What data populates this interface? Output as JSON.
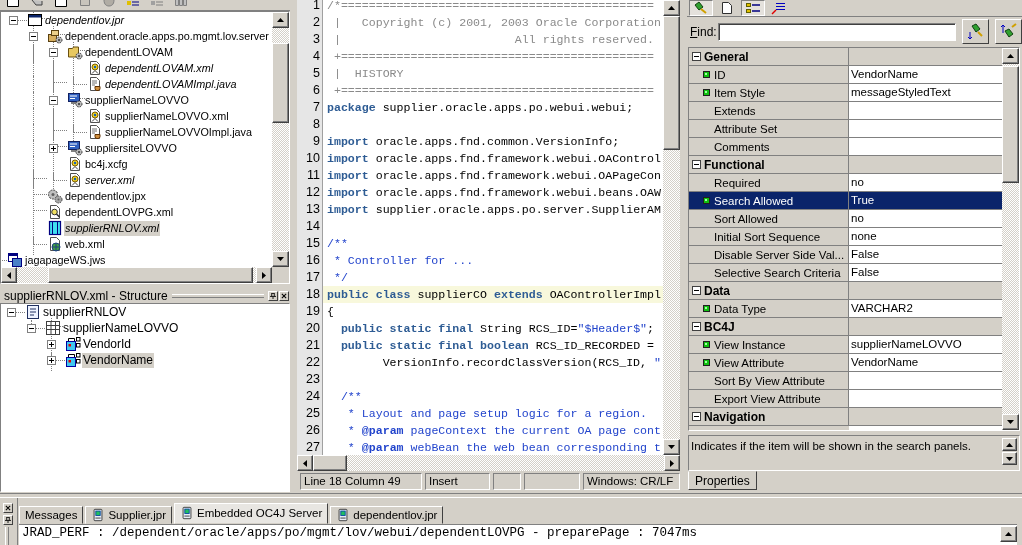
{
  "navigator": {
    "items": [
      {
        "label": "dependentlov.jpr",
        "kind": "project",
        "expanded": true,
        "modified": true,
        "selected": false,
        "children": [
          {
            "label": "dependent.oracle.apps.po.mgmt.lov.server",
            "kind": "package",
            "expanded": true,
            "modified": false,
            "selected": false,
            "children": [
              {
                "label": "dependentLOVAM",
                "kind": "module",
                "expanded": true,
                "modified": false,
                "selected": false,
                "children": [
                  {
                    "label": "dependentLOVAM.xml",
                    "kind": "xml",
                    "modified": true,
                    "selected": false
                  },
                  {
                    "label": "dependentLOVAMImpl.java",
                    "kind": "java",
                    "modified": true,
                    "selected": false
                  }
                ]
              },
              {
                "label": "supplierNameLOVVO",
                "kind": "view",
                "expanded": true,
                "modified": false,
                "selected": false,
                "children": [
                  {
                    "label": "supplierNameLOVVO.xml",
                    "kind": "xml",
                    "modified": false,
                    "selected": false
                  },
                  {
                    "label": "supplierNameLOVVOImpl.java",
                    "kind": "java",
                    "modified": false,
                    "selected": false
                  }
                ]
              },
              {
                "label": "suppliersiteLOVVO",
                "kind": "view",
                "expanded": false,
                "modified": false,
                "selected": false
              },
              {
                "label": "bc4j.xcfg",
                "kind": "xml",
                "modified": false,
                "selected": false
              },
              {
                "label": "server.xml",
                "kind": "xml",
                "modified": true,
                "selected": false
              }
            ]
          },
          {
            "label": "dependentlov.jpx",
            "kind": "gears",
            "modified": false,
            "selected": false
          },
          {
            "label": "dependentLOVPG.xml",
            "kind": "page",
            "modified": false,
            "selected": false
          },
          {
            "label": "supplierRNLOV.xml",
            "kind": "region",
            "modified": true,
            "selected": true
          },
          {
            "label": "web.xml",
            "kind": "web",
            "modified": false,
            "selected": false
          }
        ]
      },
      {
        "label": "jagapageWS.jws",
        "kind": "workspace",
        "modified": false,
        "selected": false
      }
    ]
  },
  "structure": {
    "title": "supplierRNLOV.xml - Structure",
    "items": [
      {
        "label": "supplierRNLOV",
        "kind": "document",
        "expanded": true,
        "selected": false,
        "children": [
          {
            "label": "supplierNameLOVVO",
            "kind": "table",
            "expanded": true,
            "selected": false,
            "children": [
              {
                "label": "VendorId",
                "kind": "item",
                "expanded": false,
                "selected": false
              },
              {
                "label": "VendorName",
                "kind": "item",
                "expanded": false,
                "selected": true
              }
            ]
          }
        ]
      }
    ]
  },
  "editor": {
    "lines": [
      {
        "number": "1",
        "current": false,
        "tokens": [
          {
            "kind": "comment",
            "text": "/*============================================="
          }
        ]
      },
      {
        "number": "2",
        "current": false,
        "tokens": [
          {
            "kind": "comment",
            "text": " |   Copyright (c) 2001, 2003 Oracle Corporation"
          }
        ]
      },
      {
        "number": "3",
        "current": false,
        "tokens": [
          {
            "kind": "comment",
            "text": " |                         All rights reserved."
          }
        ]
      },
      {
        "number": "4",
        "current": false,
        "tokens": [
          {
            "kind": "comment",
            "text": " +============================================="
          }
        ]
      },
      {
        "number": "5",
        "current": false,
        "tokens": [
          {
            "kind": "comment",
            "text": " |  HISTORY"
          }
        ]
      },
      {
        "number": "6",
        "current": false,
        "tokens": [
          {
            "kind": "comment",
            "text": " +============================================="
          }
        ]
      },
      {
        "number": "7",
        "current": false,
        "tokens": [
          {
            "kind": "keyword",
            "text": "package"
          },
          {
            "kind": "plain",
            "text": " supplier.oracle.apps.po.webui.webui;"
          }
        ]
      },
      {
        "number": "8"
      },
      {
        "number": "9",
        "current": false,
        "tokens": [
          {
            "kind": "keyword",
            "text": "import"
          },
          {
            "kind": "plain",
            "text": " oracle.apps.fnd.common.VersionInfo;"
          }
        ]
      },
      {
        "number": "10",
        "current": false,
        "tokens": [
          {
            "kind": "keyword",
            "text": "import"
          },
          {
            "kind": "plain",
            "text": " oracle.apps.fnd.framework.webui.OAControl"
          }
        ]
      },
      {
        "number": "11",
        "current": false,
        "tokens": [
          {
            "kind": "keyword",
            "text": "import"
          },
          {
            "kind": "plain",
            "text": " oracle.apps.fnd.framework.webui.OAPageCon"
          }
        ]
      },
      {
        "number": "12",
        "current": false,
        "tokens": [
          {
            "kind": "keyword",
            "text": "import"
          },
          {
            "kind": "plain",
            "text": " oracle.apps.fnd.framework.webui.beans.OAW"
          }
        ]
      },
      {
        "number": "13",
        "current": false,
        "tokens": [
          {
            "kind": "keyword",
            "text": "import"
          },
          {
            "kind": "plain",
            "text": " supplier.oracle.apps.po.server.SupplierAM"
          }
        ]
      },
      {
        "number": "14"
      },
      {
        "number": "15",
        "current": false,
        "tokens": [
          {
            "kind": "doc",
            "text": "/**"
          }
        ]
      },
      {
        "number": "16",
        "current": false,
        "tokens": [
          {
            "kind": "doc",
            "text": " * Controller for ..."
          }
        ]
      },
      {
        "number": "17",
        "current": false,
        "tokens": [
          {
            "kind": "doc",
            "text": " */"
          }
        ]
      },
      {
        "number": "18",
        "current": true,
        "tokens": [
          {
            "kind": "keyword",
            "text": "public class"
          },
          {
            "kind": "plain",
            "text": " supplierCO "
          },
          {
            "kind": "keyword",
            "text": "extends"
          },
          {
            "kind": "plain",
            "text": " OAControllerImpl"
          }
        ]
      },
      {
        "number": "19",
        "current": false,
        "tokens": [
          {
            "kind": "plain",
            "text": "{"
          }
        ]
      },
      {
        "number": "20",
        "current": false,
        "tokens": [
          {
            "kind": "keyword",
            "text": "  public static final"
          },
          {
            "kind": "plain",
            "text": " String RCS_ID="
          },
          {
            "kind": "string",
            "text": "\"$Header$\""
          },
          {
            "kind": "plain",
            "text": ";"
          }
        ]
      },
      {
        "number": "21",
        "current": false,
        "tokens": [
          {
            "kind": "keyword",
            "text": "  public static final boolean"
          },
          {
            "kind": "plain",
            "text": " RCS_ID_RECORDED ="
          }
        ]
      },
      {
        "number": "22",
        "current": false,
        "tokens": [
          {
            "kind": "plain",
            "text": "        VersionInfo.recordClassVersion(RCS_ID, "
          },
          {
            "kind": "string",
            "text": "\""
          }
        ]
      },
      {
        "number": "23"
      },
      {
        "number": "24",
        "current": false,
        "tokens": [
          {
            "kind": "doc",
            "text": "  /**"
          }
        ]
      },
      {
        "number": "25",
        "current": false,
        "tokens": [
          {
            "kind": "doc",
            "text": "   * Layout and page setup logic for a region."
          }
        ]
      },
      {
        "number": "26",
        "current": false,
        "tokens": [
          {
            "kind": "doc",
            "text": "   * "
          },
          {
            "kind": "doctag",
            "text": "@param"
          },
          {
            "kind": "doc",
            "text": " pageContext the current OA page cont"
          }
        ]
      },
      {
        "number": "27",
        "current": false,
        "tokens": [
          {
            "kind": "doc",
            "text": "   * "
          },
          {
            "kind": "doctag",
            "text": "@param"
          },
          {
            "kind": "doc",
            "text": " webBean the web bean corresponding t"
          }
        ]
      }
    ],
    "status_bar": {
      "position": "Line 18 Column 49",
      "mode": "Insert",
      "line_endings": "Windows: CR/LF"
    }
  },
  "properties": {
    "toolbar": [
      {
        "kind": "inspect",
        "pressed": true
      },
      {
        "kind": "page",
        "pressed": false
      },
      {
        "kind": "categories",
        "pressed": true
      },
      {
        "kind": "sort",
        "pressed": false
      }
    ],
    "find": {
      "label": "Find:"
    },
    "sections": [
      {
        "title": "General",
        "expanded": true,
        "properties": [
          {
            "name": "ID",
            "value": "VendorName",
            "set": true,
            "selected": false
          },
          {
            "name": "Item Style",
            "value": "messageStyledText",
            "set": true,
            "selected": false
          },
          {
            "name": "Extends",
            "set": false,
            "selected": false
          },
          {
            "name": "Attribute Set",
            "set": false,
            "selected": false
          },
          {
            "name": "Comments",
            "set": false,
            "selected": false
          }
        ]
      },
      {
        "title": "Functional",
        "expanded": true,
        "properties": [
          {
            "name": "Required",
            "value": "no",
            "set": false,
            "selected": false
          },
          {
            "name": "Search Allowed",
            "value": "True",
            "set": true,
            "selected": true
          },
          {
            "name": "Sort Allowed",
            "value": "no",
            "set": false,
            "selected": false
          },
          {
            "name": "Initial Sort Sequence",
            "value": "none",
            "set": false,
            "selected": false
          },
          {
            "name": "Disable Server Side Val...",
            "value": "False",
            "set": false,
            "selected": false
          },
          {
            "name": "Selective Search Criteria",
            "value": "False",
            "set": false,
            "selected": false
          }
        ]
      },
      {
        "title": "Data",
        "expanded": true,
        "properties": [
          {
            "name": "Data Type",
            "value": "VARCHAR2",
            "set": true,
            "selected": false
          }
        ]
      },
      {
        "title": "BC4J",
        "expanded": true,
        "properties": [
          {
            "name": "View Instance",
            "value": "supplierNameLOVVO",
            "set": true,
            "selected": false
          },
          {
            "name": "View Attribute",
            "value": "VendorName",
            "set": true,
            "selected": false
          },
          {
            "name": "Sort By View Attribute",
            "set": false,
            "selected": false
          },
          {
            "name": "Export View Attribute",
            "set": false,
            "selected": false
          }
        ]
      },
      {
        "title": "Navigation",
        "expanded": true
      }
    ],
    "description": "Indicates if the item will be shown in the search panels.",
    "tabs": [
      {
        "label": "Properties",
        "selected": true
      }
    ]
  },
  "log_window": {
    "tabs": [
      {
        "label": "Messages",
        "kind": "plain",
        "selected": false
      },
      {
        "label": "Supplier.jpr",
        "kind": "document",
        "selected": false
      },
      {
        "label": "Embedded OC4J Server",
        "kind": "document",
        "selected": true
      },
      {
        "label": "dependentlov.jpr",
        "kind": "document",
        "selected": false
      }
    ],
    "lines": [
      "JRAD_PERF : /dependent/oracle/apps/po/mgmt/lov/webui/dependentLOVPG - preparePage : 7047ms"
    ]
  }
}
